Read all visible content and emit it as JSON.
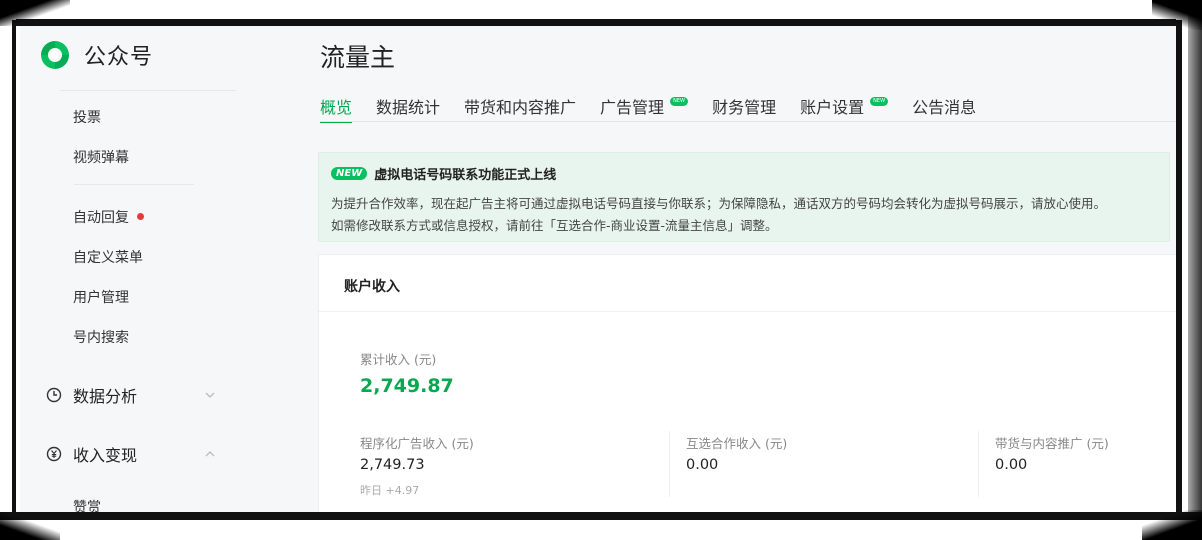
{
  "app": {
    "name": "公众号"
  },
  "sidebar": {
    "items": [
      {
        "label": "投票"
      },
      {
        "label": "视频弹幕"
      },
      {
        "label": "自动回复"
      },
      {
        "label": "自定义菜单"
      },
      {
        "label": "用户管理"
      },
      {
        "label": "号内搜索"
      }
    ],
    "groups": [
      {
        "label": "数据分析",
        "icon": "clock-icon",
        "expanded": false
      },
      {
        "label": "收入变现",
        "icon": "yen-icon",
        "expanded": true
      }
    ],
    "sub_item": {
      "label": "赞赏"
    }
  },
  "page": {
    "title": "流量主"
  },
  "tabs": [
    {
      "label": "概览",
      "active": true
    },
    {
      "label": "数据统计"
    },
    {
      "label": "带货和内容推广"
    },
    {
      "label": "广告管理",
      "badge": "NEW"
    },
    {
      "label": "财务管理"
    },
    {
      "label": "账户设置",
      "badge": "NEW"
    },
    {
      "label": "公告消息"
    }
  ],
  "notice": {
    "badge": "NEW",
    "title": "虚拟电话号码联系功能正式上线",
    "line1": "为提升合作效率，现在起广告主将可通过虚拟电话号码直接与你联系；为保障隐私，通话双方的号码均会转化为虚拟号码展示，请放心使用。",
    "line2": "如需修改联系方式或信息授权，请前往「互选合作-商业设置-流量主信息」调整。"
  },
  "income": {
    "title": "账户收入",
    "total_label": "累计收入 (元)",
    "total_value": "2,749.87",
    "metrics": [
      {
        "label": "程序化广告收入 (元)",
        "value": "2,749.73",
        "sub": "昨日 +4.97"
      },
      {
        "label": "互选合作收入 (元)",
        "value": "0.00"
      },
      {
        "label": "带货与内容推广 (元)",
        "value": "0.00"
      }
    ]
  },
  "colors": {
    "accent": "#07c160",
    "accent_text": "#07a850",
    "notice_bg": "#e8f5ee",
    "dot": "#e43a3a"
  }
}
